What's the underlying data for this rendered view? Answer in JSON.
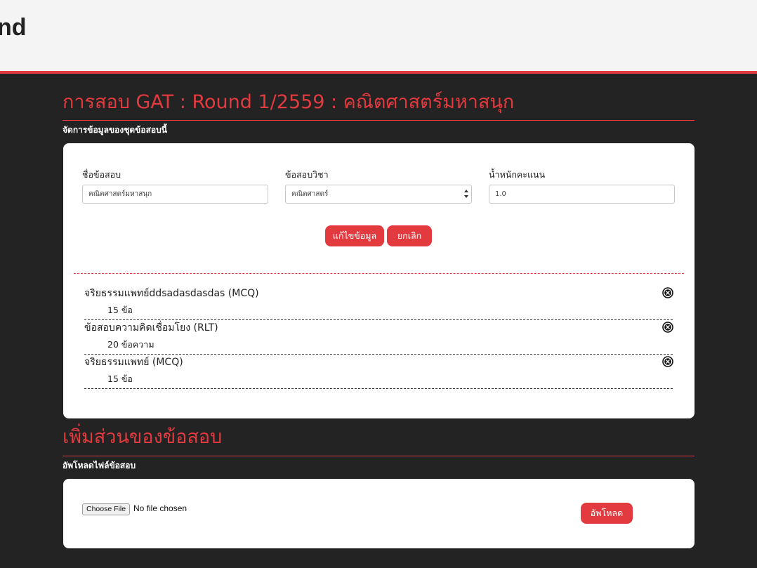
{
  "header": {
    "title": "nd"
  },
  "exam": {
    "title": "การสอบ GAT : Round 1/2559 : คณิตศาสตร์มหาสนุก",
    "subtitle": "จัดการข้อมูลของชุดข้อสอบนี้",
    "fields": {
      "name_label": "ชื่อข้อสอบ",
      "name_value": "คณิตศาสตร์มหาสนุก",
      "subject_label": "ข้อสอบวิชา",
      "subject_value": "คณิตศาสตร์",
      "weight_label": "น้ำหนักคะแนน",
      "weight_value": "1.0"
    },
    "buttons": {
      "edit": "แก้ไขข้อมูล",
      "cancel": "ยกเลิก"
    },
    "parts": [
      {
        "name": "จริยธรรมแพทย์ddsadasdasdas (MCQ)",
        "count": "15 ข้อ"
      },
      {
        "name": "ข้อสอบความคิดเชื่อมโยง (RLT)",
        "count": "20 ข้อความ"
      },
      {
        "name": "จริยธรรมแพทย์ (MCQ)",
        "count": "15 ข้อ"
      }
    ]
  },
  "add_section": {
    "title": "เพิ่มส่วนของข้อสอบ",
    "subtitle": "อัพโหลดไฟล์ข้อสอบ",
    "choose_file": "Choose File",
    "file_status": "No file chosen",
    "upload": "อัพโหลด"
  },
  "colors": {
    "accent": "#e23a3f",
    "background": "#232323",
    "card": "#ffffff"
  }
}
